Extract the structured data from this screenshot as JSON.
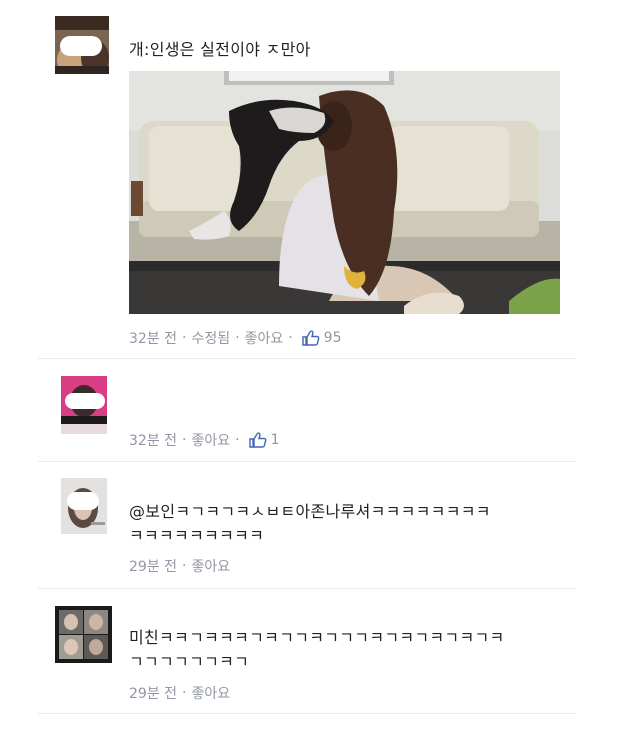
{
  "comments": [
    {
      "text": "개:인생은 실전이야 ㅈ만아",
      "time": "32분 전",
      "edited": "수정됨",
      "like": "좋아요",
      "likes": "95"
    },
    {
      "text": "",
      "time": "32분 전",
      "like": "좋아요",
      "likes": "1"
    },
    {
      "text_line1": "@보인ㅋㄱㅋㄱㅋㅅㅂㅌ아존나루셔ㅋㅋㅋㅋㅋㅋㅋㅋ",
      "text_line2": "ㅋㅋㅋㅋㅋㅋㅋㅋㅋ",
      "time": "29분 전",
      "like": "좋아요"
    },
    {
      "text_line1": "미친ㅋㅋㄱㅋㅋㅋㄱㅋㄱㄱㅋㄱㄱㄱㅋㄱㅋㄱㅋㄱㅋㄱㅋ",
      "text_line2": "ㄱㄱㄱㄱㄱㄱㅋㄱ",
      "time": "29분 전",
      "like": "좋아요"
    }
  ],
  "separator": "·",
  "colors": {
    "text": "#1d2129",
    "meta": "#9197a3",
    "like_blue": "#4267b2",
    "divider": "#e9ebee"
  },
  "icons": [
    "thumbs-up-icon"
  ]
}
